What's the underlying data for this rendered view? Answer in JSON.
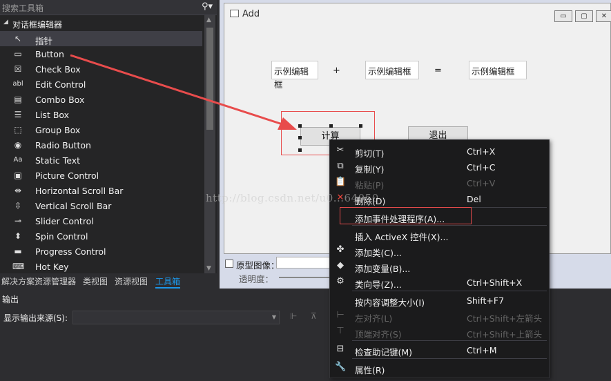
{
  "toolbox": {
    "search_placeholder": "搜索工具箱",
    "search_icon": "search-icon",
    "group_label": "对话框编辑器",
    "items": [
      {
        "label": "指针",
        "icon": "pointer-icon",
        "glyph": "↖",
        "selected": true
      },
      {
        "label": "Button",
        "icon": "button-icon",
        "glyph": "▭"
      },
      {
        "label": "Check Box",
        "icon": "checkbox-icon",
        "glyph": "☒"
      },
      {
        "label": "Edit Control",
        "icon": "edit-control-icon",
        "glyph": "abl"
      },
      {
        "label": "Combo Box",
        "icon": "combobox-icon",
        "glyph": "▤"
      },
      {
        "label": "List Box",
        "icon": "listbox-icon",
        "glyph": "☰"
      },
      {
        "label": "Group Box",
        "icon": "groupbox-icon",
        "glyph": "⬚"
      },
      {
        "label": "Radio Button",
        "icon": "radio-icon",
        "glyph": "◉"
      },
      {
        "label": "Static Text",
        "icon": "static-text-icon",
        "glyph": "Aa"
      },
      {
        "label": "Picture Control",
        "icon": "picture-icon",
        "glyph": "▣"
      },
      {
        "label": "Horizontal Scroll Bar",
        "icon": "hscroll-icon",
        "glyph": "⇹"
      },
      {
        "label": "Vertical Scroll Bar",
        "icon": "vscroll-icon",
        "glyph": "⇳"
      },
      {
        "label": "Slider Control",
        "icon": "slider-icon",
        "glyph": "⊸"
      },
      {
        "label": "Spin Control",
        "icon": "spin-icon",
        "glyph": "⬍"
      },
      {
        "label": "Progress Control",
        "icon": "progress-icon",
        "glyph": "▬"
      },
      {
        "label": "Hot Key",
        "icon": "hotkey-icon",
        "glyph": "⌨"
      }
    ]
  },
  "bottom_tabs": [
    {
      "label": "解决方案资源管理器",
      "active": false
    },
    {
      "label": "类视图",
      "active": false
    },
    {
      "label": "资源视图",
      "active": false
    },
    {
      "label": "工具箱",
      "active": true
    }
  ],
  "dialog": {
    "title": "Add",
    "edit1": "示例编辑框",
    "plus": "+",
    "edit2": "示例编辑框",
    "equals": "=",
    "edit3": "示例编辑框",
    "calc_button": "计算",
    "exit_button": "退出",
    "controls": [
      "▭",
      "▢",
      "✕"
    ]
  },
  "proto_bar": {
    "checkbox_label": "原型图像：",
    "opacity_label": "透明度："
  },
  "output": {
    "title": "输出",
    "source_label": "显示输出来源(S):"
  },
  "context_menu": [
    {
      "label": "剪切(T)",
      "shortcut": "Ctrl+X",
      "icon": "cut-icon",
      "glyph": "✂",
      "disabled": false
    },
    {
      "label": "复制(Y)",
      "shortcut": "Ctrl+C",
      "icon": "copy-icon",
      "glyph": "⧉",
      "disabled": false
    },
    {
      "label": "粘贴(P)",
      "shortcut": "Ctrl+V",
      "icon": "paste-icon",
      "glyph": "📋",
      "disabled": true
    },
    {
      "label": "删除(D)",
      "shortcut": "Del",
      "icon": "delete-icon",
      "glyph": "✕",
      "disabled": false,
      "icon_color": "#e8453c"
    },
    {
      "label": "添加事件处理程序(A)...",
      "shortcut": "",
      "icon": "",
      "glyph": "",
      "disabled": false,
      "sep_before": true
    },
    {
      "label": "插入 ActiveX 控件(X)...",
      "shortcut": "",
      "icon": "",
      "glyph": "",
      "disabled": false,
      "sep_before": true
    },
    {
      "label": "添加类(C)...",
      "shortcut": "",
      "icon": "add-class-icon",
      "glyph": "✤",
      "disabled": false
    },
    {
      "label": "添加变量(B)...",
      "shortcut": "",
      "icon": "add-variable-icon",
      "glyph": "◆",
      "disabled": false
    },
    {
      "label": "类向导(Z)...",
      "shortcut": "Ctrl+Shift+X",
      "icon": "class-wizard-icon",
      "glyph": "⚙",
      "disabled": false
    },
    {
      "label": "按内容调整大小(I)",
      "shortcut": "Shift+F7",
      "icon": "",
      "glyph": "",
      "disabled": false,
      "sep_before": true
    },
    {
      "label": "左对齐(L)",
      "shortcut": "Ctrl+Shift+左箭头",
      "icon": "align-left-icon",
      "glyph": "⊢",
      "disabled": true
    },
    {
      "label": "顶端对齐(S)",
      "shortcut": "Ctrl+Shift+上箭头",
      "icon": "align-top-icon",
      "glyph": "⊤",
      "disabled": true
    },
    {
      "label": "检查助记键(M)",
      "shortcut": "Ctrl+M",
      "icon": "check-mnemonics-icon",
      "glyph": "⊟",
      "disabled": false,
      "sep_before": true
    },
    {
      "label": "属性(R)",
      "shortcut": "",
      "icon": "properties-icon",
      "glyph": "🔧",
      "disabled": false,
      "sep_before": true
    }
  ],
  "watermark": "http://blog.csdn.net/u0...64050",
  "colors": {
    "accent": "#1c97ea",
    "annotation_red": "#e84c4c"
  }
}
